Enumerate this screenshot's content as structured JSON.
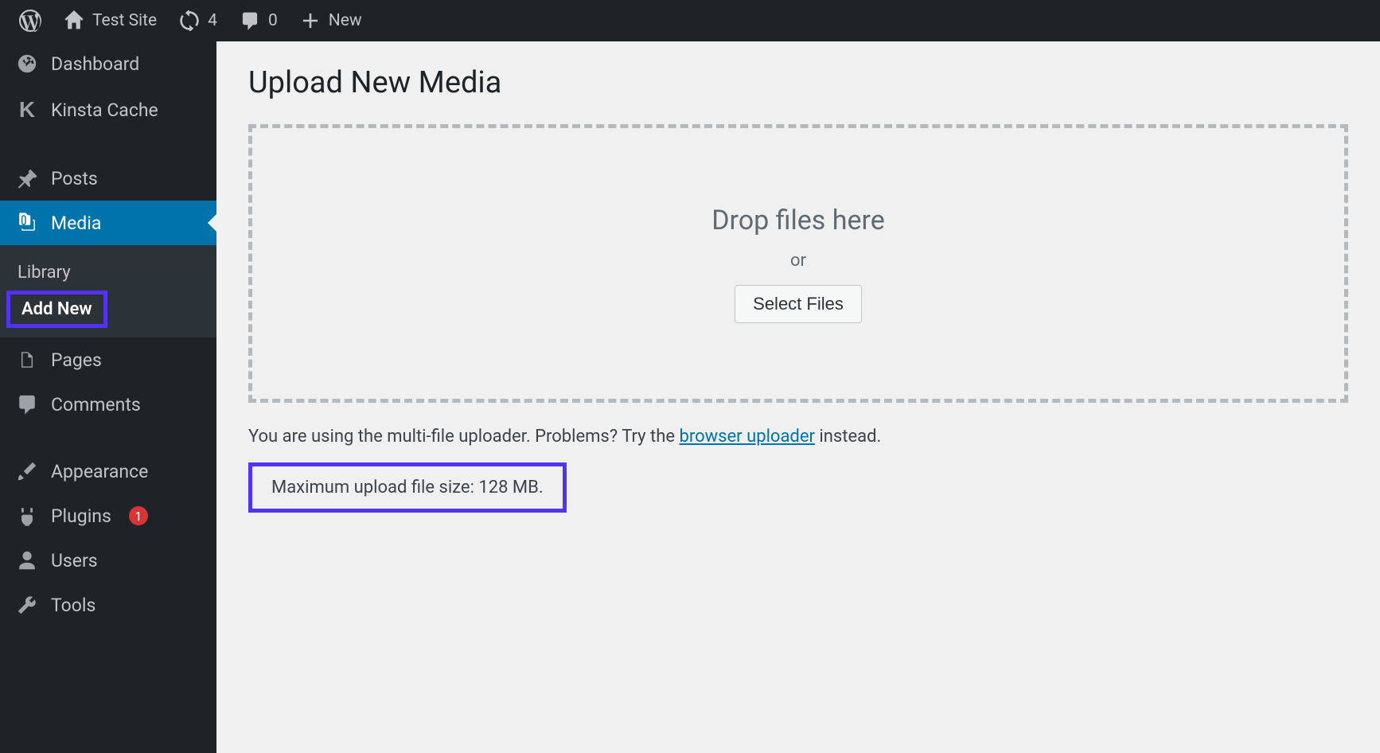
{
  "adminBar": {
    "siteName": "Test Site",
    "updateCount": "4",
    "commentCount": "0",
    "newLabel": "New"
  },
  "sidebar": {
    "dashboard": "Dashboard",
    "kinstaCache": "Kinsta Cache",
    "posts": "Posts",
    "media": "Media",
    "library": "Library",
    "addNew": "Add New",
    "pages": "Pages",
    "comments": "Comments",
    "appearance": "Appearance",
    "plugins": "Plugins",
    "pluginCount": "1",
    "users": "Users",
    "tools": "Tools"
  },
  "main": {
    "title": "Upload New Media",
    "dropText": "Drop files here",
    "orText": "or",
    "selectFiles": "Select Files",
    "helperPre": "You are using the multi-file uploader. Problems? Try the ",
    "helperLink": "browser uploader",
    "helperPost": " instead.",
    "maxUpload": "Maximum upload file size: 128 MB."
  }
}
